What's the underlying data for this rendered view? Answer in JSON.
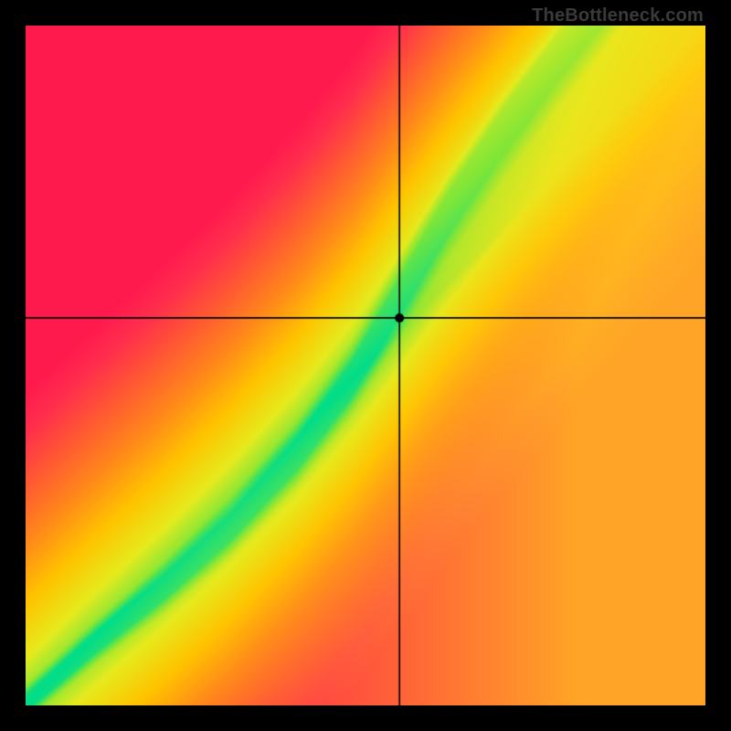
{
  "watermark": "TheBottleneck.com",
  "chart_data": {
    "type": "heatmap",
    "title": "",
    "xlabel": "",
    "ylabel": "",
    "xlim": [
      0,
      1
    ],
    "ylim": [
      0,
      1
    ],
    "crosshair": {
      "x": 0.55,
      "y": 0.57
    },
    "marker": {
      "x": 0.55,
      "y": 0.57
    },
    "ridge": {
      "description": "Green optimal band running from bottom-left to top-right with a slight S-curve; width ~0.04–0.06 of the axis",
      "points": [
        {
          "x": 0.02,
          "y": 0.02
        },
        {
          "x": 0.1,
          "y": 0.09
        },
        {
          "x": 0.2,
          "y": 0.17
        },
        {
          "x": 0.3,
          "y": 0.26
        },
        {
          "x": 0.4,
          "y": 0.37
        },
        {
          "x": 0.48,
          "y": 0.48
        },
        {
          "x": 0.55,
          "y": 0.6
        },
        {
          "x": 0.62,
          "y": 0.72
        },
        {
          "x": 0.7,
          "y": 0.84
        },
        {
          "x": 0.78,
          "y": 0.95
        },
        {
          "x": 0.82,
          "y": 1.0
        }
      ]
    },
    "color_stops": [
      {
        "t": 0.0,
        "color": "#00DD8A"
      },
      {
        "t": 0.1,
        "color": "#7BE63A"
      },
      {
        "t": 0.22,
        "color": "#E6EB1E"
      },
      {
        "t": 0.38,
        "color": "#FFC400"
      },
      {
        "t": 0.55,
        "color": "#FF8A1A"
      },
      {
        "t": 0.72,
        "color": "#FF5A33"
      },
      {
        "t": 0.88,
        "color": "#FF2E4D"
      },
      {
        "t": 1.0,
        "color": "#FF1A4D"
      }
    ],
    "upper_right_tint": "#FFD21A"
  }
}
